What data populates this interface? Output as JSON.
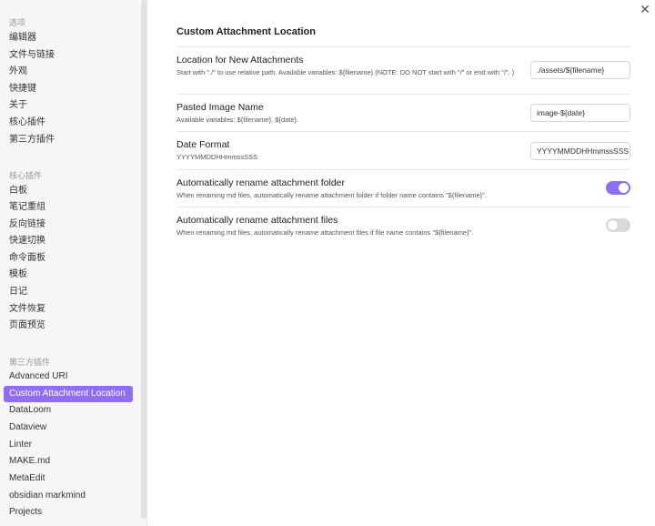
{
  "sidebar": {
    "group_options": "选项",
    "options_items": [
      "编辑器",
      "文件与链接",
      "外观",
      "快捷键",
      "关于",
      "核心插件",
      "第三方插件"
    ],
    "group_core": "核心插件",
    "core_items": [
      "白板",
      "笔记重组",
      "反向链接",
      "快速切换",
      "命令面板",
      "模板",
      "日记",
      "文件恢复",
      "页面预览"
    ],
    "group_third": "第三方插件",
    "third_items": [
      "Advanced URI",
      "Custom Attachment Location",
      "DataLoom",
      "Dataview",
      "Linter",
      "MAKE.md",
      "MetaEdit",
      "obsidian markmind",
      "Projects"
    ],
    "active_item": "Custom Attachment Location"
  },
  "close_icon": "close-icon",
  "page": {
    "title": "Custom Attachment Location"
  },
  "settings": {
    "location": {
      "name": "Location for New Attachments",
      "desc": "Start with \"./\" to use relative path. Available variables: ${filename}.(NOTE: DO NOT start with \"/\" or end with \"/\". )",
      "value": "./assets/${filename}"
    },
    "pasted": {
      "name": "Pasted Image Name",
      "desc": "Available variables: ${filename}, ${date}.",
      "value": "image-${date}"
    },
    "date_format": {
      "name": "Date Format",
      "desc": "YYYYMMDDHHmmssSSS",
      "value": "YYYYMMDDHHmmssSSS"
    },
    "rename_folder": {
      "name": "Automatically rename attachment folder",
      "desc": "When renaming md files, automatically rename attachment folder if folder name contains \"${filename}\".",
      "enabled": true
    },
    "rename_files": {
      "name": "Automatically rename attachment files",
      "desc": "When renaming md files, automatically rename attachment files if file name contains \"${filename}\".",
      "enabled": false
    }
  },
  "colors": {
    "accent": "#8f6ef2",
    "toggle_off": "#d9d9d9"
  }
}
